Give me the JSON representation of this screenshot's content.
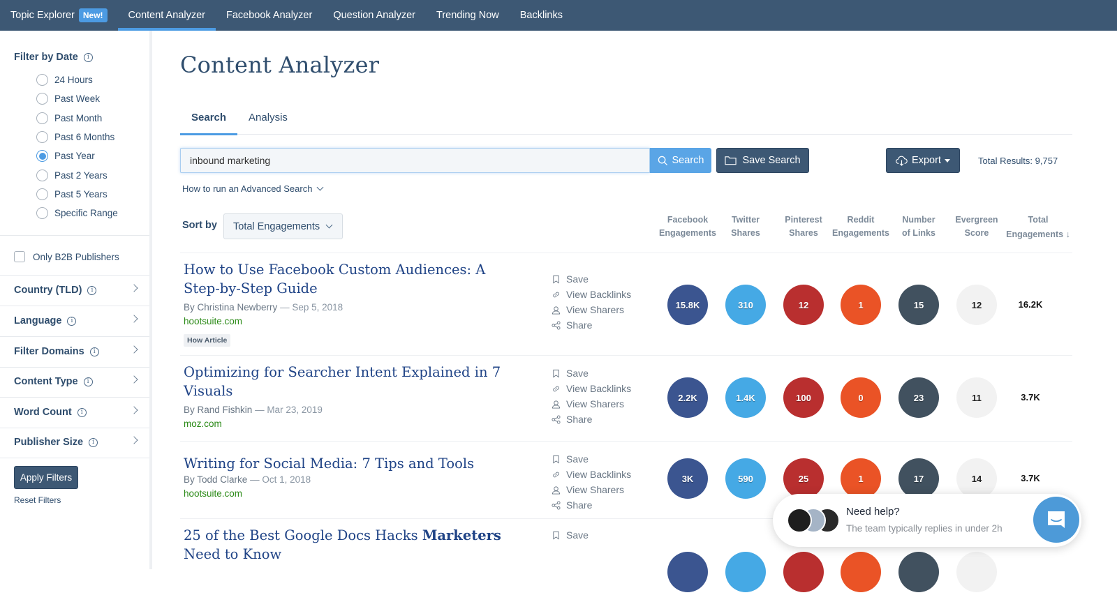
{
  "topnav": {
    "items": [
      {
        "label": "Topic Explorer",
        "badge": "New!"
      },
      {
        "label": "Content Analyzer"
      },
      {
        "label": "Facebook Analyzer"
      },
      {
        "label": "Question Analyzer"
      },
      {
        "label": "Trending Now"
      },
      {
        "label": "Backlinks"
      }
    ],
    "active_index": 1
  },
  "sidebar": {
    "date_filter_title": "Filter by Date",
    "date_options": [
      "24 Hours",
      "Past Week",
      "Past Month",
      "Past 6 Months",
      "Past Year",
      "Past 2 Years",
      "Past 5 Years",
      "Specific Range"
    ],
    "selected_date": "Past Year",
    "b2b_label": "Only B2B Publishers",
    "b2b_checked": false,
    "filters": [
      "Country (TLD)",
      "Language",
      "Filter Domains",
      "Content Type",
      "Word Count",
      "Publisher Size"
    ],
    "apply_label": "Apply Filters",
    "reset_label": "Reset Filters"
  },
  "main": {
    "title": "Content Analyzer",
    "tabs": [
      {
        "label": "Search"
      },
      {
        "label": "Analysis"
      }
    ],
    "active_tab": "Search",
    "search_value": "inbound marketing",
    "search_button": "Search",
    "save_search_button": "Save Search",
    "export_button": "Export",
    "total_results": "Total Results: 9,757",
    "advanced_link": "How to run an Advanced Search",
    "sort_label": "Sort by",
    "sort_value": "Total Engagements",
    "columns": [
      {
        "line1": "Facebook",
        "line2": "Engagements"
      },
      {
        "line1": "Twitter",
        "line2": "Shares"
      },
      {
        "line1": "Pinterest",
        "line2": "Shares"
      },
      {
        "line1": "Reddit",
        "line2": "Engagements"
      },
      {
        "line1": "Number",
        "line2": "of Links"
      },
      {
        "line1": "Evergreen",
        "line2": "Score"
      },
      {
        "line1": "Total",
        "line2": "Engagements ↓"
      }
    ],
    "actions": [
      "Save",
      "View Backlinks",
      "View Sharers",
      "Share"
    ],
    "metric_colors": {
      "facebook": "#3b5590",
      "twitter": "#45a9e5",
      "pinterest": "#b92f2f",
      "reddit": "#ea5326",
      "links": "#41515f",
      "evergreen": "#f2f2f2"
    },
    "results": [
      {
        "title": "How to Use Facebook Custom Audiences: A Step-by-Step Guide",
        "author": "By Christina Newberry",
        "date": "— Sep 5, 2018",
        "domain": "hootsuite.com",
        "tag": "How Article",
        "facebook": "15.8K",
        "twitter": "310",
        "pinterest": "12",
        "reddit": "1",
        "links": "15",
        "evergreen": "12",
        "total": "16.2K"
      },
      {
        "title": "Optimizing for Searcher Intent Explained in 7 Visuals",
        "author": "By Rand Fishkin",
        "date": "— Mar 23, 2019",
        "domain": "moz.com",
        "facebook": "2.2K",
        "twitter": "1.4K",
        "pinterest": "100",
        "reddit": "0",
        "links": "23",
        "evergreen": "11",
        "total": "3.7K"
      },
      {
        "title": "Writing for Social Media: 7 Tips and Tools",
        "author": "By Todd Clarke",
        "date": "— Oct 1, 2018",
        "domain": "hootsuite.com",
        "facebook": "3K",
        "twitter": "590",
        "pinterest": "25",
        "reddit": "1",
        "links": "17",
        "evergreen": "14",
        "total": "3.7K"
      },
      {
        "title_pre": "25 of the Best Google Docs Hacks ",
        "title_bold": "Marketers",
        "title_post": " Need to Know"
      }
    ]
  },
  "help_widget": {
    "title": "Need help?",
    "subtitle": "The team typically replies in under 2h"
  }
}
